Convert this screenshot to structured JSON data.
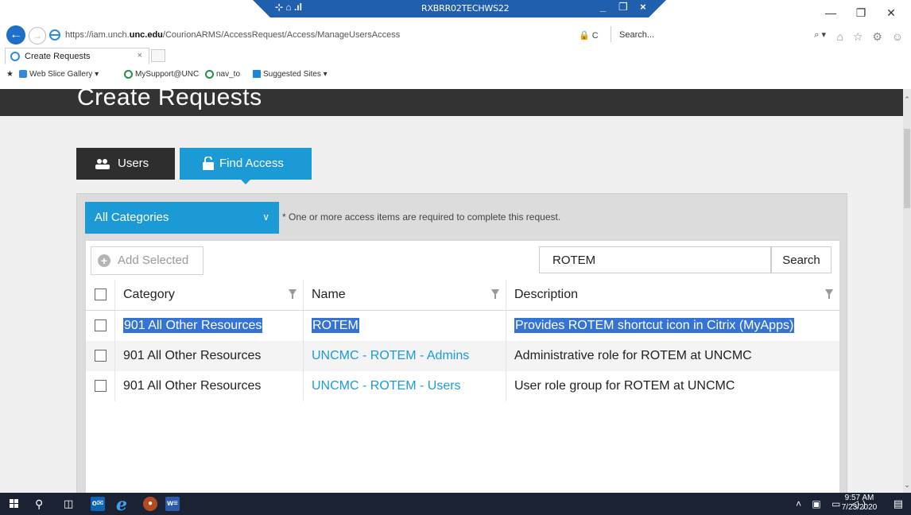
{
  "remote_session": {
    "title": "RXBRR02TECHWS22",
    "icons": "⊹ ⌂ .ıl",
    "window_buttons": "_ ❐ ×"
  },
  "browser": {
    "url_prefix": "https://iam.unch.",
    "url_host": "unc.edu",
    "url_path": "/CourionARMS/AccessRequest/Access/ManageUsersAccess",
    "address_tools": "🔒 C",
    "search_placeholder": "Search...",
    "search_tools": "⌕ ▾",
    "toolbar_icons": "⌂ ☆ ⚙ ☺",
    "window_controls": {
      "minimize": "—",
      "maximize": "❐",
      "close": "✕"
    },
    "tab": {
      "label": "Create Requests",
      "close": "×"
    },
    "favorites": [
      {
        "label": "Web Slice Gallery ▾",
        "icon": "web-slice-icon"
      },
      {
        "label": "MySupport@UNC",
        "icon": "globe-icon"
      },
      {
        "label": "nav_to",
        "icon": "globe-icon"
      },
      {
        "label": "Suggested Sites ▾",
        "icon": "bing-icon"
      }
    ]
  },
  "page": {
    "title": "Create Requests",
    "tabs": [
      {
        "label": "Users",
        "icon": "users-icon",
        "active": false
      },
      {
        "label": "Find Access",
        "icon": "lock-icon",
        "active": true
      }
    ],
    "category_select": {
      "value": "All Categories",
      "chevron": "∨"
    },
    "required_note": "* One or more access items are required to complete this request.",
    "add_selected_label": "Add Selected",
    "add_selected_icon": "+",
    "search": {
      "value": "ROTEM",
      "button_label": "Search"
    },
    "table": {
      "columns": [
        "Category",
        "Name",
        "Description"
      ],
      "rows": [
        {
          "category": "901 All Other Resources",
          "name": "ROTEM",
          "description": "Provides ROTEM shortcut icon in Citrix (MyApps)",
          "highlighted": true
        },
        {
          "category": "901 All Other Resources",
          "name": "UNCMC - ROTEM - Admins",
          "description": "Administrative role for ROTEM at UNCMC",
          "highlighted": false
        },
        {
          "category": "901 All Other Resources",
          "name": "UNCMC - ROTEM - Users",
          "description": "User role group for ROTEM at UNCMC",
          "highlighted": false
        }
      ]
    }
  },
  "taskbar": {
    "items": [
      "start-icon",
      "search-icon",
      "task-view-icon",
      "outlook-icon",
      "internet-explorer-icon",
      "app-icon",
      "word-icon"
    ],
    "ie_glyph": "e",
    "outlook_glyph": "o✉",
    "word_glyph": "w≡",
    "app_glyph": "●",
    "tray_icons": "˄ ▣ ▭ ◁)",
    "time": "9:57 AM",
    "date": "7/23/2020",
    "notification": "▤"
  },
  "colors": {
    "accent": "#1b9ad6",
    "header_bg": "#333333",
    "users_tab_bg": "#2e2e2e",
    "selection": "#3573d4",
    "remote_bar": "#1f5fae",
    "taskbar": "#1b2233"
  }
}
